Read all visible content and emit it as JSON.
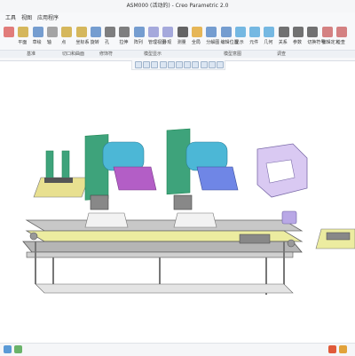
{
  "window": {
    "title": "ASM000 (活动的) - Creo Parametric 2.0"
  },
  "menubar": {
    "items": [
      "工具",
      "视图",
      "应用程序"
    ]
  },
  "ribbon": {
    "tools": [
      {
        "name": "regenerate-tool",
        "label": "",
        "color": "#d9534f"
      },
      {
        "name": "plane-tool",
        "label": "平面",
        "color": "#c9a227"
      },
      {
        "name": "sketch-tool",
        "label": "草绘",
        "color": "#4a7fc1"
      },
      {
        "name": "axis-tool",
        "label": "轴",
        "color": "#888"
      },
      {
        "name": "point-tool",
        "label": "点",
        "color": "#c9a227"
      },
      {
        "name": "coord-tool",
        "label": "坐标系",
        "color": "#c9a227"
      },
      {
        "name": "rotate-tool",
        "label": "旋转",
        "color": "#4a7fc1"
      },
      {
        "name": "align-tool",
        "label": "孔",
        "color": "#555"
      },
      {
        "name": "scale-tool",
        "label": "拉伸",
        "color": "#555"
      },
      {
        "name": "array-tool",
        "label": "阵列",
        "color": "#4a7fc1"
      },
      {
        "name": "manage-view-tool",
        "label": "管理视图",
        "color": "#8a8fd1"
      },
      {
        "name": "appearance-tool",
        "label": "外观",
        "color": "#8a8fd1"
      },
      {
        "name": "material-tool",
        "label": "测量",
        "color": "#333"
      },
      {
        "name": "check-tool",
        "label": "全局",
        "color": "#e0a020"
      },
      {
        "name": "explode-tool",
        "label": "分解图",
        "color": "#4a7fc1"
      },
      {
        "name": "edit-position-tool",
        "label": "编辑位置",
        "color": "#4a7fc1"
      },
      {
        "name": "show-tool",
        "label": "显示",
        "color": "#4aa3d9"
      },
      {
        "name": "component-tool",
        "label": "元件",
        "color": "#4aa3d9"
      },
      {
        "name": "geometry-tool",
        "label": "几何",
        "color": "#4aa3d9"
      },
      {
        "name": "relations-tool",
        "label": "关系",
        "color": "#444"
      },
      {
        "name": "parameters-tool",
        "label": "参数",
        "color": "#444"
      },
      {
        "name": "switch-symbol-tool",
        "label": "切换符号",
        "color": "#444"
      },
      {
        "name": "edit-def-tool",
        "label": "编辑定义",
        "color": "#c85a5a"
      },
      {
        "name": "user-tool",
        "label": "检查",
        "color": "#c85a5a"
      }
    ],
    "groups": [
      "基准",
      "切口和曲面",
      "修饰符",
      "模型显示",
      "模型意图",
      "调查"
    ]
  },
  "view_toolbar": {
    "buttons": [
      "zoom-in-icon",
      "zoom-out-icon",
      "refit-icon",
      "repaint-icon",
      "shading-icon",
      "saved-views-icon",
      "view-manager-icon",
      "datum-display-icon",
      "annotation-icon",
      "spin-center-icon",
      "perspective-icon"
    ]
  },
  "status": {
    "field": ""
  },
  "colors": {
    "accent": "#3a6fb0"
  }
}
